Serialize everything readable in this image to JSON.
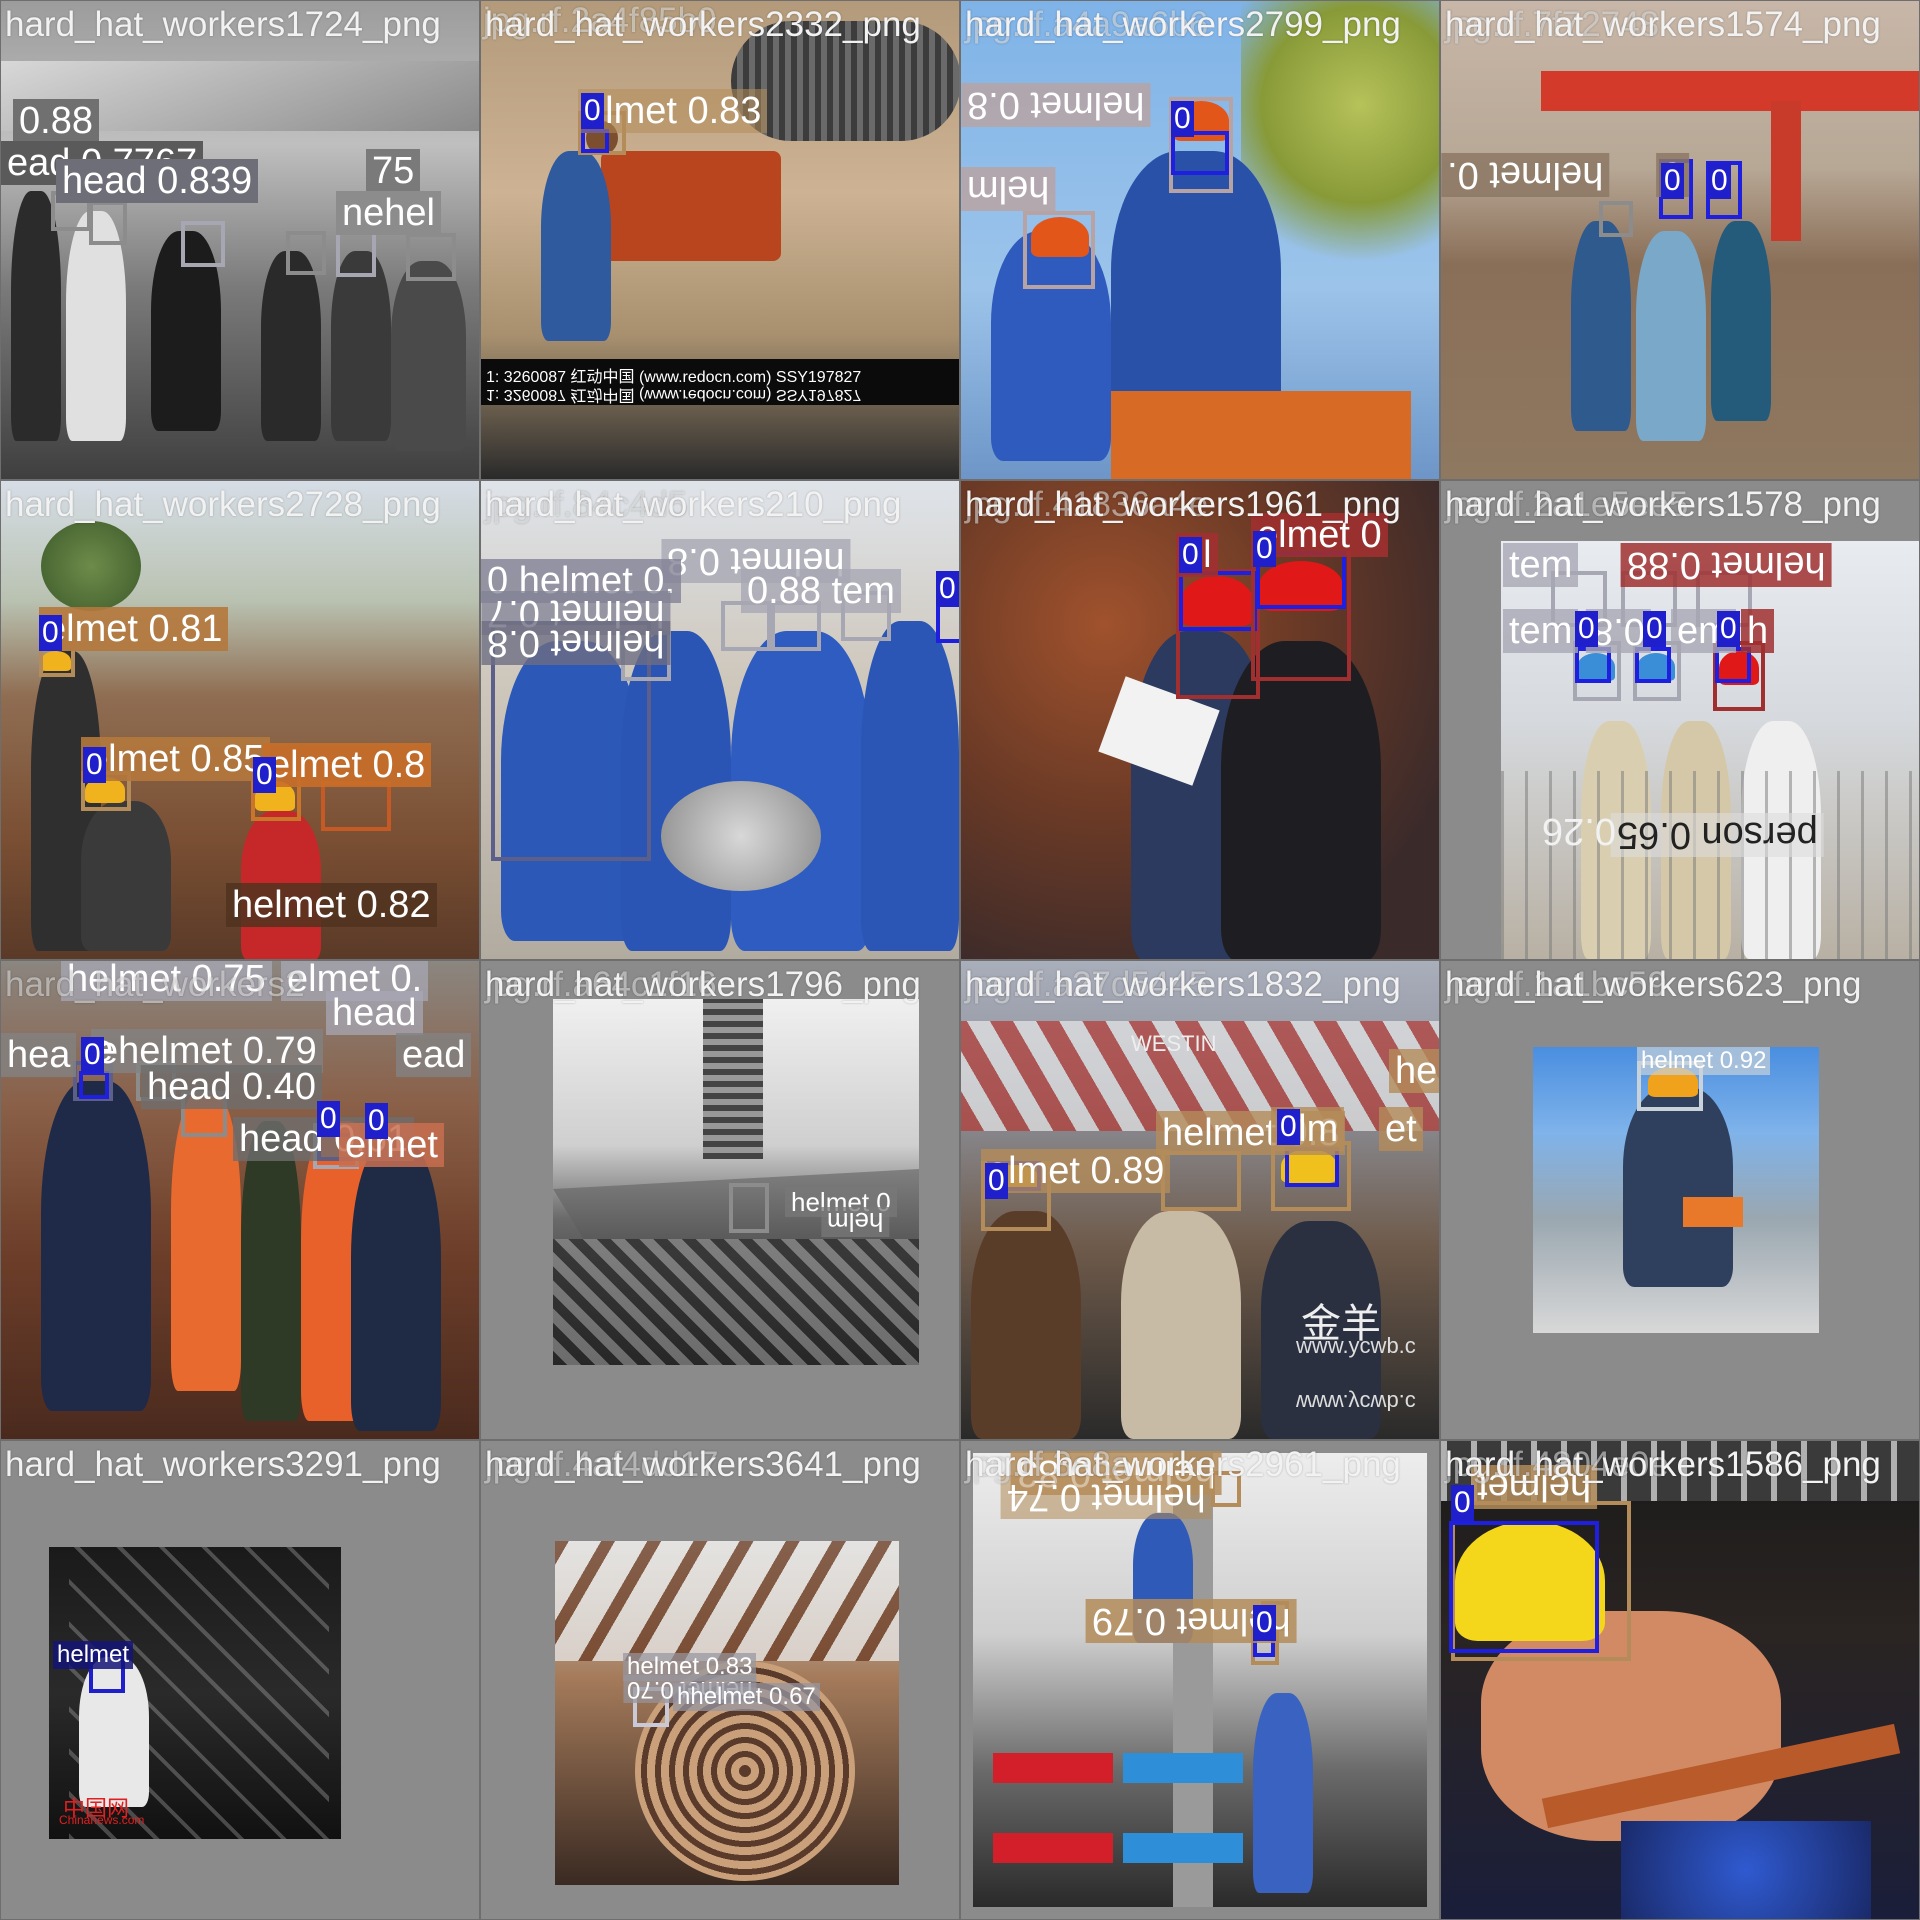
{
  "tiles": [
    {
      "title": "hard_hat_workers1724_png",
      "labels": [
        "0.88",
        "head 0.839",
        "75",
        "nehel"
      ],
      "overlaps": [
        "ead 0.7767",
        "head"
      ]
    },
    {
      "title": "hard_hat_workers2332_png",
      "ghost": "jpg.rf.2a4f85b0",
      "labels": [
        "elmet 0.83"
      ],
      "class_ids": [
        "0"
      ],
      "watermark_top": "1: 3260087   红动中国 (www.redocn.com)   SSY197827",
      "watermark_bottom": "1: 3260087   红动中国 (www.redocn.com)   SSY197827"
    },
    {
      "title": "hard_hat_workers2799_png",
      "ghost": "jpg.rf.a4a9a6b6",
      "labels": [
        "helmet 0.8",
        "helm"
      ],
      "class_ids": [
        "0"
      ]
    },
    {
      "title": "hard_hat_workers1574_png",
      "ghost": "jpg.rf.7f72748",
      "labels": [
        "helmet 0.",
        "e"
      ],
      "class_ids": [
        "0",
        "0"
      ]
    },
    {
      "title": "hard_hat_workers2728_png",
      "labels": [
        "elmet 0.81",
        "elmet 0.85",
        "elmet 0.8",
        "helmet 0.82"
      ],
      "class_ids": [
        "0",
        "0",
        "0"
      ]
    },
    {
      "title": "hard_hat_workers210_png",
      "ghost": "jpg.rf.84c4d5",
      "labels": [
        "helmet 0.8",
        "0 helmet 0.",
        "0.88 tem",
        "helmet 0.7",
        "helmet 0.8"
      ],
      "class_ids": [
        "0"
      ]
    },
    {
      "title": "hard_hat_workers1961_png",
      "ghost": "jpg.rf.41836a4e",
      "labels": [
        "el",
        "elmet 0"
      ],
      "class_ids": [
        "0",
        "0"
      ]
    },
    {
      "title": "hard_hat_workers1578_png",
      "ghost": "jpg.rf.2a1e5ee5",
      "labels": [
        "tem",
        "helmet 0.88",
        "tem",
        "0.8",
        "em",
        "h",
        "person 0.65",
        "0.26"
      ],
      "class_ids": [
        "0",
        "0",
        "0"
      ]
    },
    {
      "title": "hard_hat_workers2",
      "labels": [
        "helmet 0.75",
        "elmet 0.",
        "head",
        "hea",
        "ehelmet 0.79",
        "ead",
        "head 0.40",
        "head 0.61",
        "e",
        "elmet"
      ],
      "class_ids": [
        "0",
        "0",
        "0"
      ]
    },
    {
      "title": "hard_hat_workers1796_png",
      "ghost": "jpg.rf.a64c1f16",
      "labels": [
        "helmet 0",
        "helm"
      ]
    },
    {
      "title": "hard_hat_workers1832_png",
      "ghost": "jpg.rf.a27d5445",
      "labels": [
        "he",
        "helmet 0.8",
        "elmet 0.89",
        "elm",
        "et"
      ],
      "class_ids": [
        "0",
        "0"
      ],
      "signs": [
        "WESTIN",
        "www.ycwb.c",
        "www.ycwb.c",
        "金羊"
      ]
    },
    {
      "title": "hard_hat_workers623_png",
      "ghost": "jpg.rf.1a1bc59",
      "labels": [
        "helmet 0.92"
      ]
    },
    {
      "title": "hard_hat_workers3291_png",
      "labels": [
        "helmet"
      ],
      "watermarks": [
        "中国网",
        "Chinanews.com"
      ]
    },
    {
      "title": "hard_hat_workers3641_png",
      "ghost": "jpg.rf.4af4dd17",
      "labels": [
        "helmet 0.83",
        "helmet 0.70",
        "hhelmet 0.67"
      ]
    },
    {
      "title": "hard_hat_workers2961_png",
      "ghost": "jpg.rf.3e8a",
      "labels": [
        "helmet 0.83",
        "helmet 0.74",
        "helmet 0.79"
      ],
      "class_ids": [
        "0"
      ]
    },
    {
      "title": "hard_hat_workers1586_png",
      "ghost": "jpg.rf.4804e0e",
      "labels": [
        "helmet"
      ],
      "class_ids": [
        "0"
      ]
    }
  ],
  "colors": {
    "helmet_box": "#b48c5a",
    "head_box": "#a7a7b4",
    "class_box": "#1f1fe0",
    "person_box": "#8c8c8c",
    "background": "#8b8b8b"
  }
}
